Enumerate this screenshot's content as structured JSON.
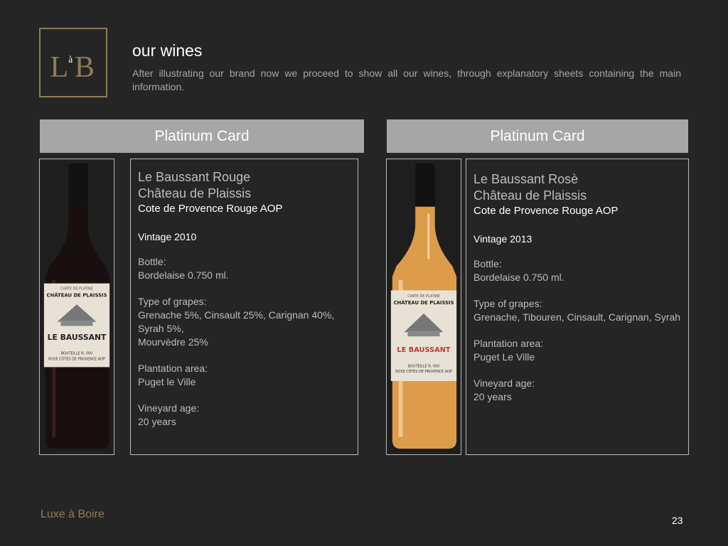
{
  "logo": {
    "text_l": "L",
    "text_a": "à",
    "text_b": "B"
  },
  "header": {
    "title": "our wines",
    "subtitle": "After illustrating our brand now we proceed to show all our wines, through explanatory sheets containing the main information."
  },
  "cards": [
    {
      "header": "Platinum Card",
      "name": "Le Baussant Rouge",
      "chateau": "Château de Plaissis",
      "appellation": "Cote de Provence Rouge AOP",
      "vintage": "Vintage  2010",
      "bottle_label": "Bottle:",
      "bottle_value": "Bordelaise 0.750 ml.",
      "grapes_label": "Type of grapes:",
      "grapes_value_1": "Grenache 5%, Cinsault  25%, Carignan 40%, Syrah 5%,",
      "grapes_value_2": "Mourvèdre 25%",
      "area_label": "Plantation area:",
      "area_value": "Puget le Ville",
      "age_label": "Vineyard age:",
      "age_value": "20 years",
      "bottle_color": "#1a0f0f"
    },
    {
      "header": "Platinum Card",
      "name": "Le Baussant  Rosè",
      "chateau": "Château de Plaissis",
      "appellation": "Cote de Provence Rouge AOP",
      "vintage": "Vintage  2013",
      "bottle_label": "Bottle:",
      "bottle_value": "Bordelaise 0.750 ml.",
      "grapes_label": "Type of grapes:",
      "grapes_value_1": "Grenache, Tibouren, Cinsault, Carignan, Syrah",
      "area_label": "Plantation area:",
      "area_value": "Puget Le Ville",
      "age_label": "Vineyard age:",
      "age_value": "20 years",
      "bottle_color": "#e0a050"
    }
  ],
  "bottle_labels": {
    "carte": "CARTE DE PLATINE",
    "chateau": "CHÂTEAU DE PLAISSIS",
    "wine": "LE BAUSSANT",
    "bottle_no": "BOUTEILLE N. 000",
    "region": "ROSE CÔTES DE PROVENCE AOP"
  },
  "footer": {
    "brand": "Luxe à Boire",
    "page": "23"
  },
  "colors": {
    "background": "#252525",
    "gold": "#8d7d55",
    "header_bar": "#a6a6a6"
  }
}
